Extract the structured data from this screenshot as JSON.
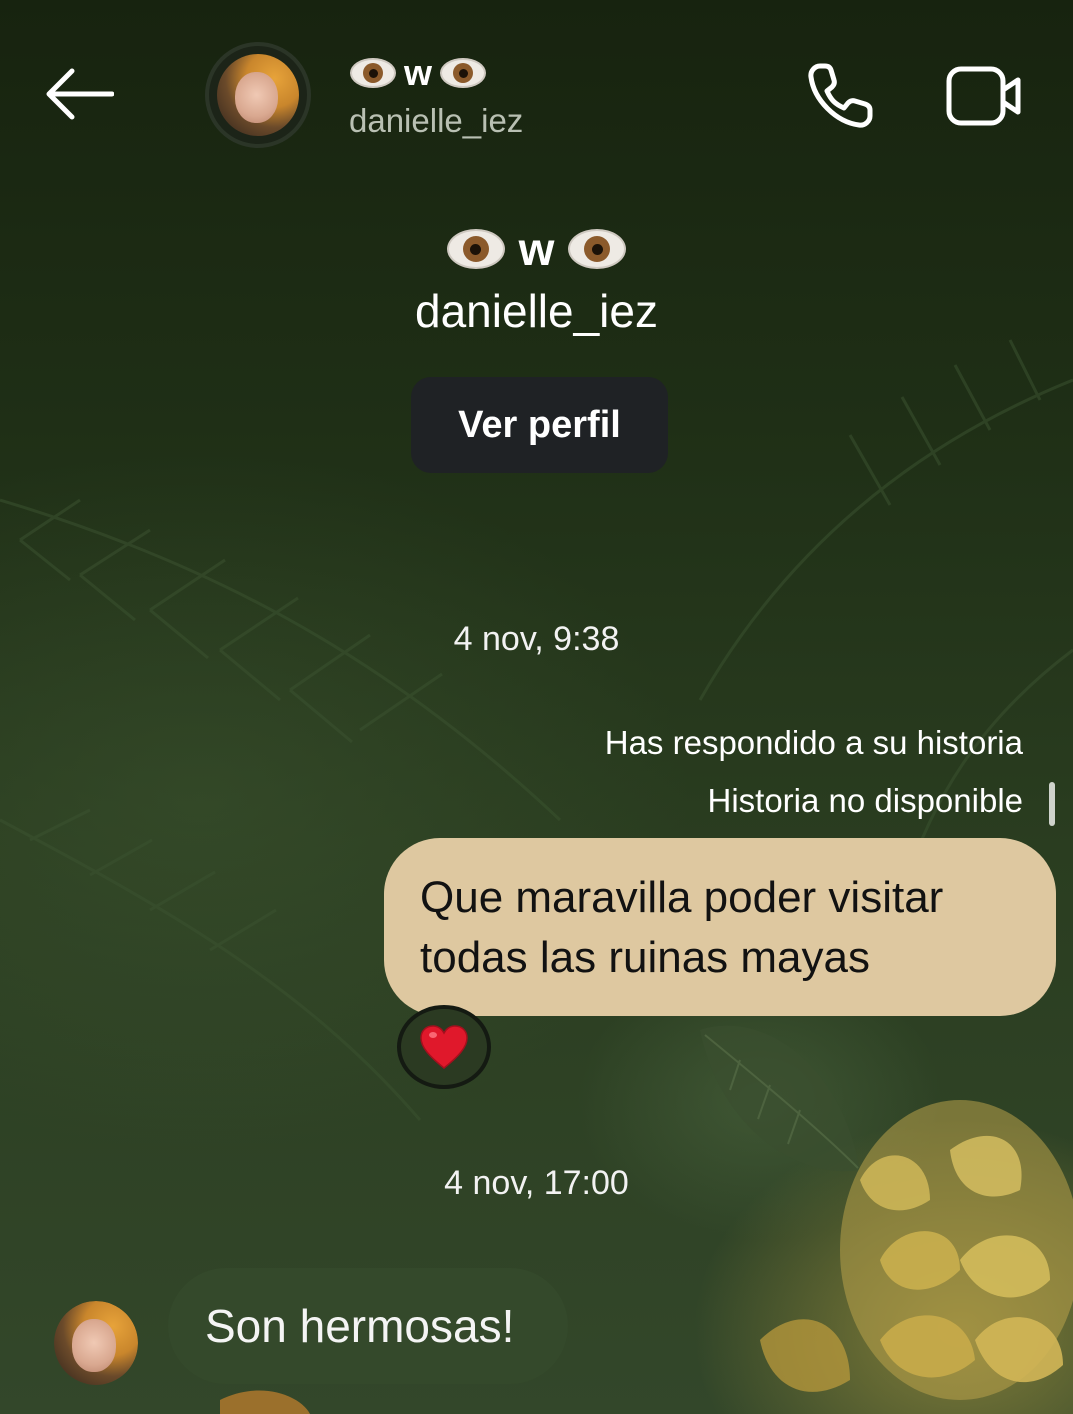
{
  "header": {
    "name_text": "w",
    "username": "danielle_iez",
    "icons": [
      "back-arrow-icon",
      "eye-emoji",
      "phone-icon",
      "video-camera-icon"
    ]
  },
  "profile": {
    "name_text": "w",
    "username": "danielle_iez",
    "view_profile_label": "Ver perfil"
  },
  "conversation": {
    "timestamp_1": "4 nov, 9:38",
    "reply_note": "Has respondido a su historia",
    "story_status": "Historia no disponible",
    "sent_message": "Que maravilla poder visitar todas las ruinas mayas",
    "reaction": "❤️",
    "timestamp_2": "4 nov, 17:00",
    "received_message": "Son hermosas!"
  },
  "colors": {
    "sent_bubble": "#dec8a0",
    "received_bubble": "#34492b",
    "button_bg": "#1f2225",
    "reaction_heart": "#e0182b"
  }
}
